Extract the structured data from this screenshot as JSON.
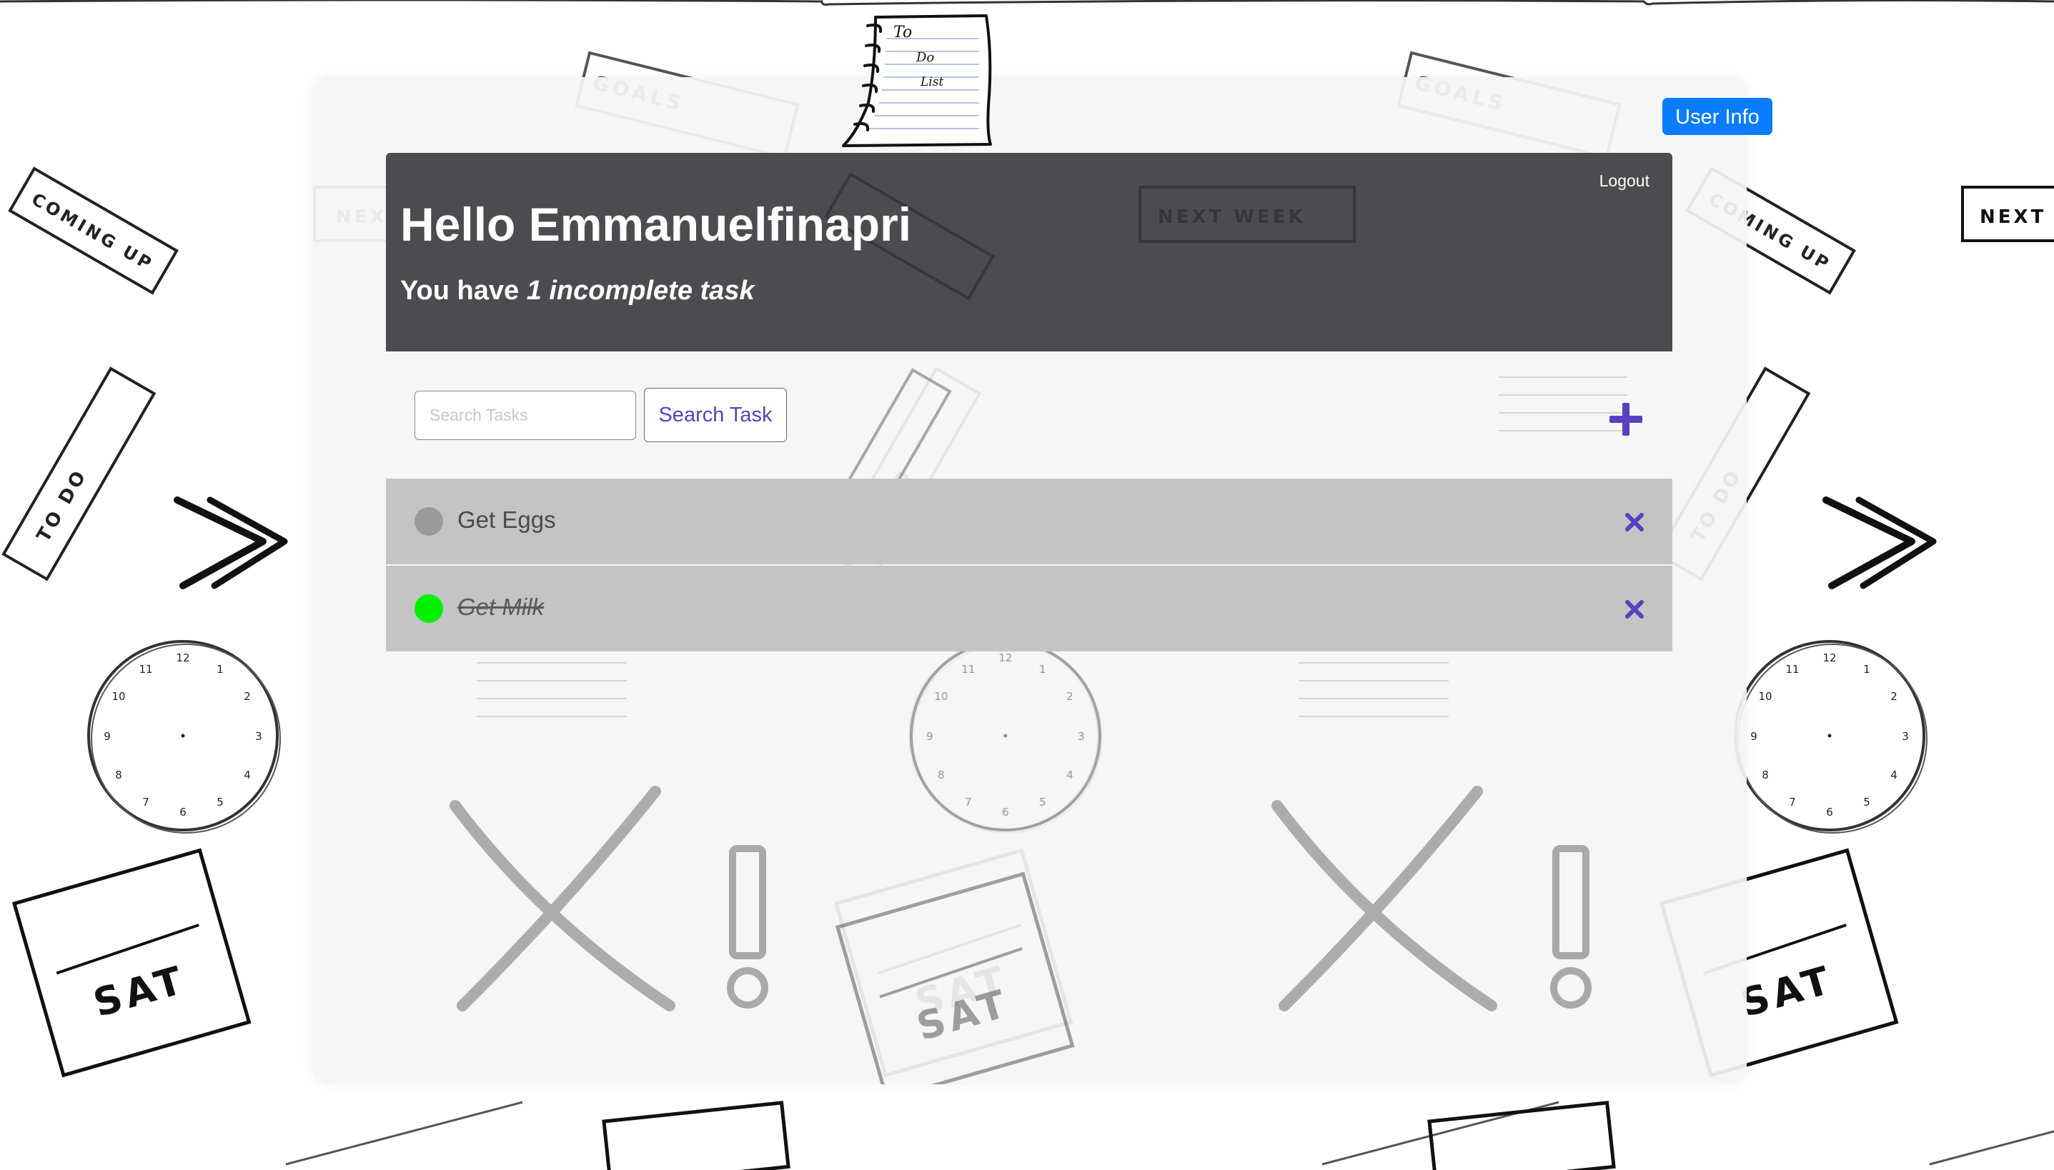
{
  "app": {
    "logo_icon": "todo-list-notepad-icon",
    "logo_text": [
      "To",
      "Do",
      "List"
    ]
  },
  "top_bar": {
    "user_info_label": "User Info"
  },
  "header": {
    "logout_label": "Logout",
    "greeting": "Hello Emmanuelfinapri",
    "summary_prefix": "You have ",
    "summary_count_text": "1 incomplete task"
  },
  "search": {
    "placeholder": "Search Tasks",
    "value": "",
    "button_label": "Search Task"
  },
  "add_task": {
    "icon": "plus-icon"
  },
  "tasks": [
    {
      "label": "Get Eggs",
      "completed": false,
      "status_color": "#9a9a9a",
      "delete_icon": "close-icon"
    },
    {
      "label": "Get Milk",
      "completed": true,
      "status_color": "#00f000",
      "delete_icon": "close-icon"
    }
  ],
  "background_decor": {
    "stamp_words": [
      "GOALS",
      "COMING UP",
      "NEXT WEEK",
      "TO DO",
      "SAT"
    ],
    "icons": [
      "clock-icon",
      "double-chevron-right-icon",
      "x-mark-icon",
      "exclamation-icon"
    ]
  },
  "colors": {
    "accent": "#5a3fc0",
    "primary_button": "#0a7cff",
    "header_bg": "#4b4c50",
    "task_bg": "#c3c4c3",
    "completed_dot": "#00f000",
    "incomplete_dot": "#9a9a9a"
  }
}
